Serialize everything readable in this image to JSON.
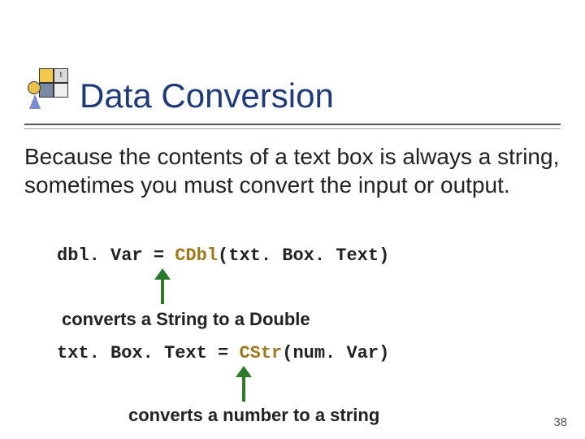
{
  "title": "Data Conversion",
  "body": "Because the contents of a text box is always a string, sometimes you must convert the input or output.",
  "code1_pre": "dbl. Var = ",
  "code1_kw": "CDbl",
  "code1_post": "(txt. Box. Text)",
  "note1": "converts a String to a Double",
  "code2_pre": "txt. Box. Text = ",
  "code2_kw": "CStr",
  "code2_post": "(num. Var)",
  "note2": "converts a number to a string",
  "page": "38",
  "logo_cell_b": "t"
}
